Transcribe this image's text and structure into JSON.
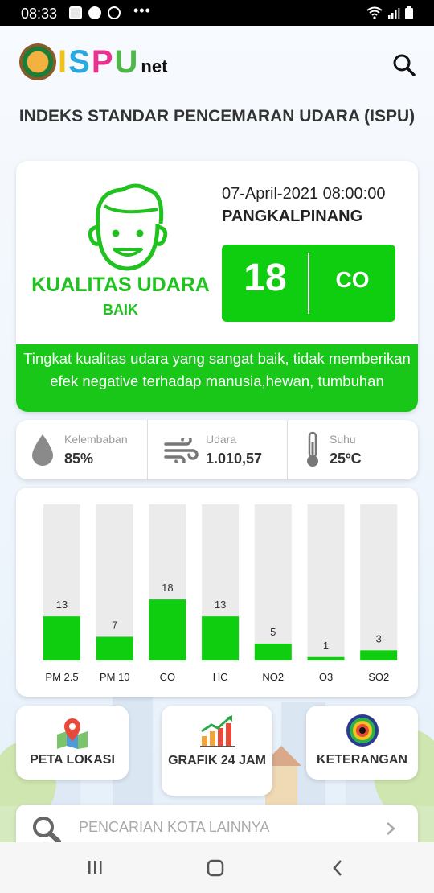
{
  "status_bar": {
    "time": "08:33",
    "icons": [
      "news-icon",
      "facebook-icon",
      "messenger-icon",
      "more-icon",
      "wifi-icon",
      "signal-icon",
      "battery-icon"
    ]
  },
  "header": {
    "logo_text": "ISPU",
    "logo_suffix": "net",
    "search_icon": "search-icon"
  },
  "page_title": "INDEKS STANDAR PENCEMARAN UDARA (ISPU)",
  "air_quality": {
    "label": "KUALITAS UDARA",
    "category": "BAIK",
    "datetime": "07-April-2021 08:00:00",
    "location": "PANGKALPINANG",
    "index_value": "18",
    "dominant_parameter": "CO",
    "description": "Tingkat kualitas udara yang sangat baik, tidak memberikan efek negative terhadap manusia,hewan, tumbuhan",
    "accent_color": "#19c719"
  },
  "weather": {
    "humidity": {
      "label": "Kelembaban",
      "value": "85%",
      "icon": "water-drop-icon"
    },
    "air": {
      "label": "Udara",
      "value": "1.010,57",
      "icon": "wind-icon"
    },
    "temperature": {
      "label": "Suhu",
      "value": "25ºC",
      "icon": "thermometer-icon"
    }
  },
  "chart_data": {
    "type": "bar",
    "categories": [
      "PM 2.5",
      "PM 10",
      "CO",
      "HC",
      "NO2",
      "O3",
      "SO2"
    ],
    "values": [
      13,
      7,
      18,
      13,
      5,
      1,
      3
    ],
    "ylim": [
      0,
      46
    ],
    "grid": false,
    "bar_color": "#0fce0f",
    "track_color": "#ebebeb"
  },
  "buttons": [
    {
      "label": "PETA LOKASI",
      "icon": "map-pin-icon"
    },
    {
      "label": "GRAFIK 24 JAM",
      "icon": "bar-chart-icon"
    },
    {
      "label": "KETERANGAN",
      "icon": "info-target-icon"
    }
  ],
  "city_search": {
    "placeholder": "PENCARIAN KOTA LAINNYA"
  },
  "nav_bar": {
    "icons": [
      "recent-apps-icon",
      "home-icon",
      "back-icon"
    ]
  }
}
